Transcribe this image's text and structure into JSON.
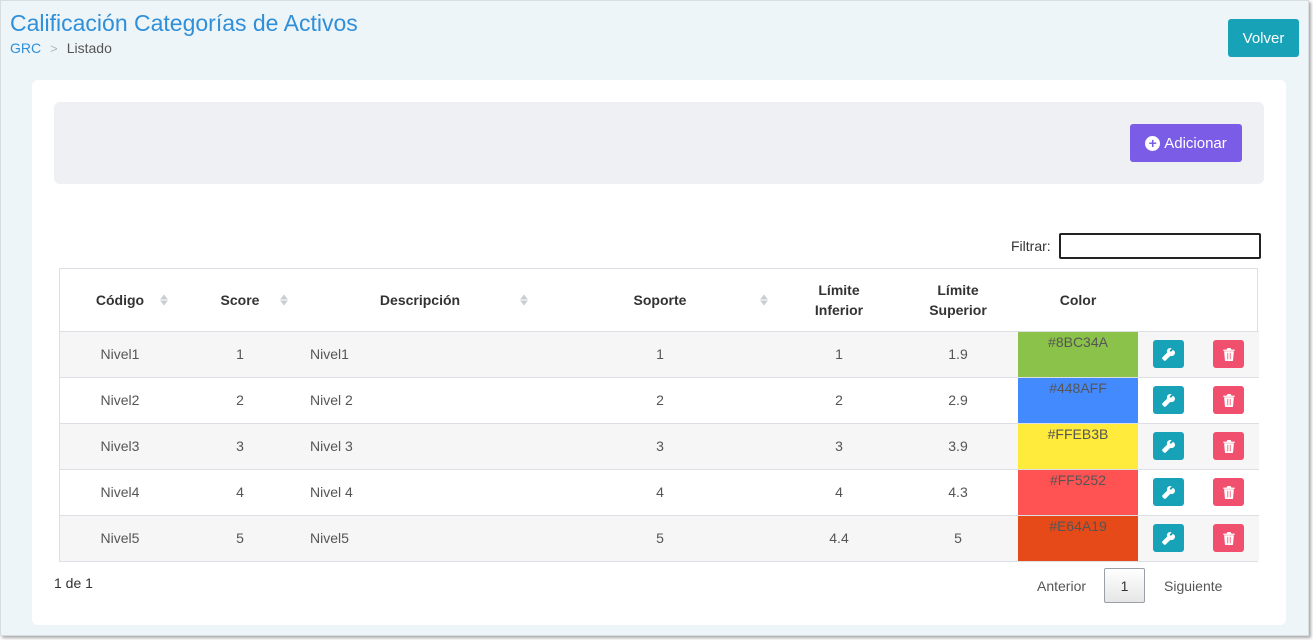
{
  "header": {
    "title": "Calificación Categorías de Activos",
    "breadcrumb": {
      "root": "GRC",
      "separator": ">",
      "current": "Listado"
    },
    "back_label": "Volver"
  },
  "toolbar": {
    "add_label": "Adicionar",
    "add_icon": "plus-circle-icon"
  },
  "filter": {
    "label": "Filtrar:",
    "value": ""
  },
  "table": {
    "columns": [
      "Código",
      "Score",
      "Descripción",
      "Soporte",
      "Límite Inferior",
      "Límite Superior",
      "Color"
    ],
    "rows": [
      {
        "codigo": "Nivel1",
        "score": "1",
        "descripcion": "Nivel1",
        "soporte": "1",
        "inferior": "1",
        "superior": "1.9",
        "color": "#8BC34A"
      },
      {
        "codigo": "Nivel2",
        "score": "2",
        "descripcion": "Nivel 2",
        "soporte": "2",
        "inferior": "2",
        "superior": "2.9",
        "color": "#448AFF"
      },
      {
        "codigo": "Nivel3",
        "score": "3",
        "descripcion": "Nivel 3",
        "soporte": "3",
        "inferior": "3",
        "superior": "3.9",
        "color": "#FFEB3B"
      },
      {
        "codigo": "Nivel4",
        "score": "4",
        "descripcion": "Nivel 4",
        "soporte": "4",
        "inferior": "4",
        "superior": "4.3",
        "color": "#FF5252"
      },
      {
        "codigo": "Nivel5",
        "score": "5",
        "descripcion": "Nivel5",
        "soporte": "5",
        "inferior": "4.4",
        "superior": "5",
        "color": "#E64A19"
      }
    ],
    "row_actions": {
      "edit_icon": "wrench-icon",
      "delete_icon": "trash-icon"
    }
  },
  "pagination": {
    "info": "1 de 1",
    "prev": "Anterior",
    "current": "1",
    "next": "Siguiente"
  },
  "colors": {
    "accent": "#2f8fd8",
    "info_button": "#17a2b8",
    "add_button": "#7b5ce6",
    "danger_button": "#f0506e"
  }
}
